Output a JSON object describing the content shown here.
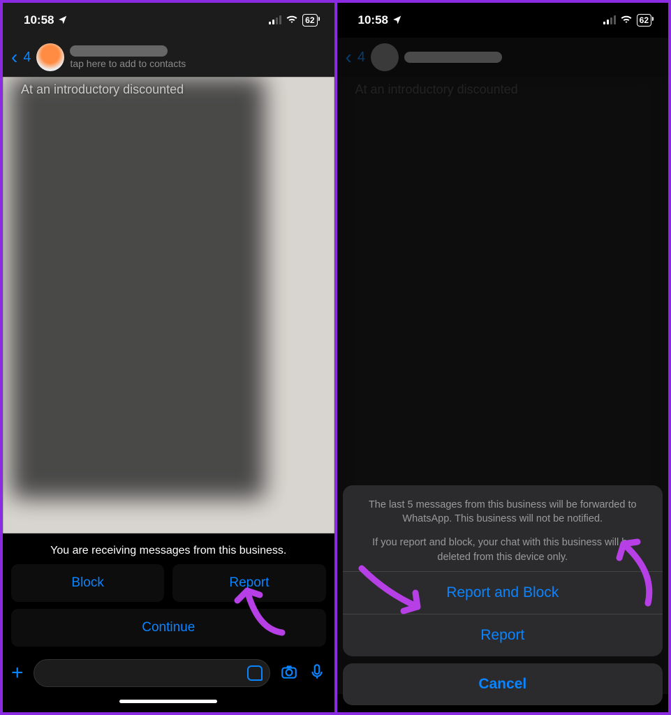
{
  "status": {
    "time": "10:58",
    "battery": "62"
  },
  "left": {
    "back_count": "4",
    "contact_sub": "tap here to add to contacts",
    "intro_snippet": "At an introductory discounted",
    "business_msg": "You are receiving messages from this business.",
    "buttons": {
      "block": "Block",
      "report": "Report",
      "continue": "Continue"
    }
  },
  "right": {
    "back_count": "4",
    "sheet": {
      "desc1": "The last 5 messages from this business will be forwarded to WhatsApp. This business will not be notified.",
      "desc2": "If you report and block, your chat with this business will be deleted from this device only.",
      "report_block": "Report and Block",
      "report": "Report",
      "cancel": "Cancel"
    }
  }
}
